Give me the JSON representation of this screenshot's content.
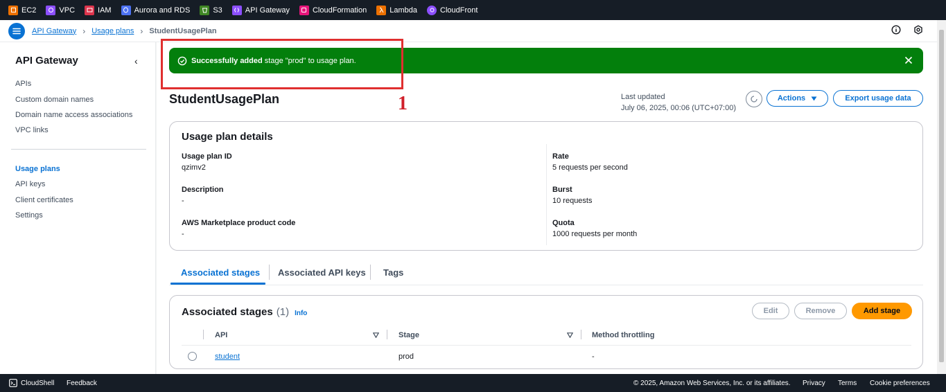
{
  "favorites": [
    {
      "label": "EC2",
      "color": "#ed7100",
      "icon": "ec2-icon"
    },
    {
      "label": "VPC",
      "color": "#8c4fff",
      "icon": "vpc-icon"
    },
    {
      "label": "IAM",
      "color": "#dd344c",
      "icon": "iam-icon"
    },
    {
      "label": "Aurora and RDS",
      "color": "#4d72f3",
      "icon": "rds-icon"
    },
    {
      "label": "S3",
      "color": "#3f8624",
      "icon": "s3-icon"
    },
    {
      "label": "API Gateway",
      "color": "#8c4fff",
      "icon": "api-gateway-icon"
    },
    {
      "label": "CloudFormation",
      "color": "#e7157b",
      "icon": "cloudformation-icon"
    },
    {
      "label": "Lambda",
      "color": "#ed7100",
      "icon": "lambda-icon"
    },
    {
      "label": "CloudFront",
      "color": "#8c4fff",
      "icon": "cloudfront-icon"
    }
  ],
  "breadcrumb": {
    "items": [
      "API Gateway",
      "Usage plans"
    ],
    "current": "StudentUsagePlan"
  },
  "sidebar": {
    "title": "API Gateway",
    "group1": [
      "APIs",
      "Custom domain names",
      "Domain name access associations",
      "VPC links"
    ],
    "group2": [
      "Usage plans",
      "API keys",
      "Client certificates",
      "Settings"
    ],
    "active": "Usage plans"
  },
  "flash": {
    "bold": "Successfully added",
    "text": " stage \"prod\" to usage plan.",
    "color": "#037f0c"
  },
  "annotation": {
    "number": "1",
    "color": "#e02f2f"
  },
  "page": {
    "title": "StudentUsagePlan",
    "last_updated_label": "Last updated",
    "last_updated_value": "July 06, 2025, 00:06 (UTC+07:00)",
    "actions_label": "Actions",
    "export_label": "Export usage data"
  },
  "details": {
    "title": "Usage plan details",
    "left": [
      {
        "label": "Usage plan ID",
        "value": "qzimv2"
      },
      {
        "label": "Description",
        "value": "-"
      },
      {
        "label": "AWS Marketplace product code",
        "value": "-"
      }
    ],
    "right": [
      {
        "label": "Rate",
        "value": "5 requests per second"
      },
      {
        "label": "Burst",
        "value": "10 requests"
      },
      {
        "label": "Quota",
        "value": "1000 requests per month"
      }
    ]
  },
  "tabs": [
    "Associated stages",
    "Associated API keys",
    "Tags"
  ],
  "stages": {
    "title": "Associated stages",
    "count": "(1)",
    "info": "Info",
    "edit_label": "Edit",
    "remove_label": "Remove",
    "add_label": "Add stage",
    "columns": [
      "API",
      "Stage",
      "Method throttling"
    ],
    "rows": [
      {
        "api": "student",
        "stage": "prod",
        "throttling": "-"
      }
    ]
  },
  "footer": {
    "cloudshell": "CloudShell",
    "feedback": "Feedback",
    "copyright": "© 2025, Amazon Web Services, Inc. or its affiliates.",
    "privacy": "Privacy",
    "terms": "Terms",
    "cookies": "Cookie preferences"
  }
}
